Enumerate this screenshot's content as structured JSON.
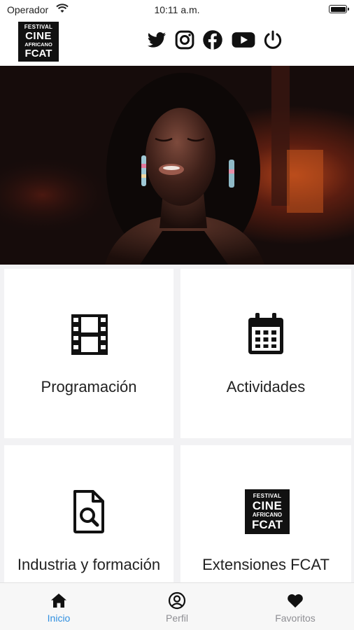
{
  "status_bar": {
    "carrier": "Operador",
    "time": "10:11 a.m."
  },
  "header": {
    "logo": {
      "line1": "FESTIVAL",
      "line2": "CINE",
      "line3": "AFRICANO",
      "line4": "FCAT"
    },
    "social_icons": [
      "twitter-icon",
      "instagram-icon",
      "facebook-icon",
      "youtube-icon",
      "power-icon"
    ]
  },
  "menu": {
    "programacion": {
      "label": "Programación",
      "icon": "film-icon"
    },
    "actividades": {
      "label": "Actividades",
      "icon": "calendar-icon"
    },
    "industria": {
      "label": "Industria y formación",
      "icon": "document-search-icon"
    },
    "extensiones": {
      "label": "Extensiones FCAT",
      "icon": "fcat-logo"
    }
  },
  "tabbar": {
    "active_color": "#2f8fe0",
    "inactive_color": "#8e8e93",
    "tabs": [
      {
        "label": "Inicio",
        "icon": "home-icon",
        "active": true
      },
      {
        "label": "Perfil",
        "icon": "user-circle-icon",
        "active": false
      },
      {
        "label": "Favoritos",
        "icon": "heart-icon",
        "active": false
      }
    ]
  }
}
